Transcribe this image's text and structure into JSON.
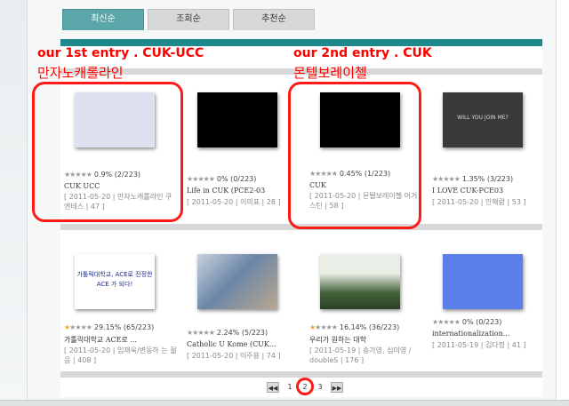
{
  "tabs": [
    {
      "label": "최신순",
      "active": true
    },
    {
      "label": "조회순",
      "active": false
    },
    {
      "label": "추천순",
      "active": false
    }
  ],
  "annotations": {
    "first_line1": "our 1st entry . CUK-UCC",
    "first_line2": "만자노캐롤라인",
    "second_line1": "our 2nd entry . CUK",
    "second_line2": "몬텔보레이첼"
  },
  "items": [
    {
      "thumb_color": "#dde1f0",
      "stars_on": 0,
      "rating": "0.9% (2/223)",
      "title": "CUK UCC",
      "meta": "[ 2011-05-20 | 만자노캐롤라인 쿠엔테스 | 47 ]"
    },
    {
      "thumb_color": "#000000",
      "stars_on": 0,
      "rating": "0% (0/223)",
      "title": "Life in CUK (PCE2-03",
      "meta": "[ 2011-05-20 | 이의표 | 28 ]"
    },
    {
      "thumb_color": "#000000",
      "stars_on": 0,
      "rating": "0.45% (1/223)",
      "title": "CUK",
      "meta": "[ 2011-05-20 | 몬텔보레이첼 어거스틴 | 58 ]"
    },
    {
      "thumb_color": "#3a3a3a",
      "thumb_text": "WILL YOU JOIN ME?",
      "stars_on": 0,
      "rating": "1.35% (3/223)",
      "title": "I LOVE CUK-PCE03",
      "meta": "[ 2011-05-20 | 안해람 | 53 ]"
    },
    {
      "thumb_color": "#ffffff",
      "thumb_text": "가톨릭대학교, ACE로 진정한 ACE 가 되다!",
      "stars_on": 1,
      "rating": "29.15% (65/223)",
      "title": "가톨릭대학교 ACE로 ...",
      "meta": "[ 2011-05-20 | 임재욱/변동하 는 젊음 | 408 ]"
    },
    {
      "thumb_color": "#6b86a8",
      "stars_on": 0,
      "rating": "2.24% (5/223)",
      "title": "Catholic U Kome (CUK...",
      "meta": "[ 2011-05-20 | 이주용 | 74 ]"
    },
    {
      "thumb_color": "#44633a",
      "stars_on": 1,
      "rating": "16.14% (36/223)",
      "title": "우리가 원하는 대학",
      "meta": "[ 2011-05-19 | 송가영, 심미영 / doubleS | 176 ]"
    },
    {
      "thumb_color": "#5b7fe8",
      "stars_on": 0,
      "rating": "0% (0/223)",
      "title": "internationalization...",
      "meta": "[ 2011-05-19 | 김다정 | 41 ]"
    }
  ],
  "pager": {
    "prev": "◀◀",
    "pages": [
      "1",
      "2",
      "3"
    ],
    "current": "2",
    "next": "▶▶"
  },
  "star_glyphs": "★★★★★"
}
